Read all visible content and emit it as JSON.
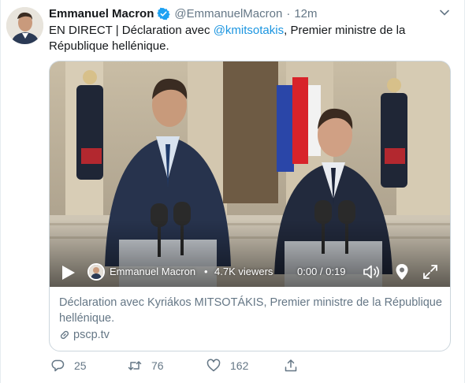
{
  "tweet": {
    "author_name": "Emmanuel Macron",
    "handle": "@EmmanuelMacron",
    "separator": "·",
    "time": "12m",
    "text_before": "EN DIRECT | Déclaration avec ",
    "mention": "@kmitsotakis",
    "text_after": ", Premier ministre de la République hellénique."
  },
  "card": {
    "streamer": "Emmanuel Macron",
    "bullet": "•",
    "viewers": "4.7K viewers",
    "timer": "0:00 / 0:19",
    "title": "Déclaration avec Kyriákos MITSOTÁKIS, Premier ministre de la République hellénique.",
    "link": "pscp.tv"
  },
  "actions": {
    "replies": "25",
    "retweets": "76",
    "likes": "162"
  },
  "colors": {
    "link_blue": "#1b95e0",
    "verified_blue": "#1da1f2",
    "muted": "#657786",
    "border": "#ccd6dd"
  }
}
